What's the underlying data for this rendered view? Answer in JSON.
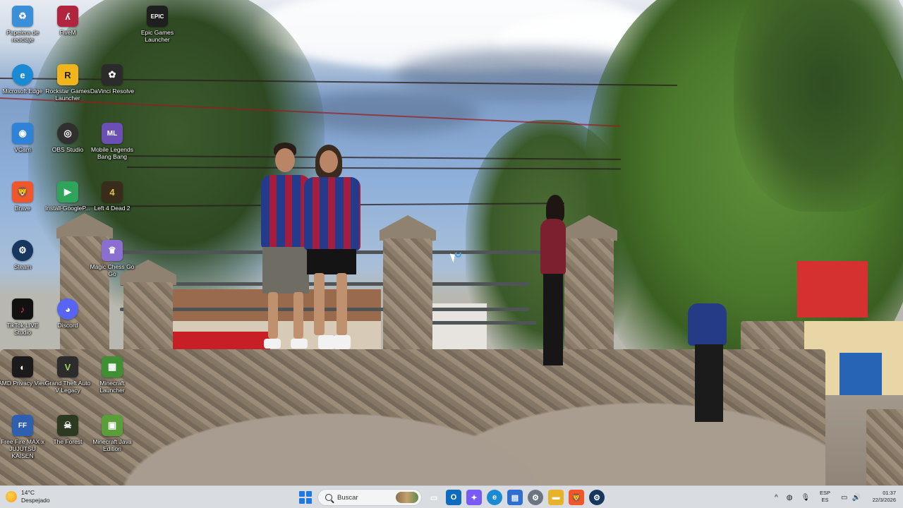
{
  "desktop_icons": [
    {
      "label": "Papelera de reciclaje",
      "icon": "recycle-bin-icon",
      "color": "#3a8fd9",
      "glyph": "♻"
    },
    {
      "label": "FiveM",
      "icon": "fivem-icon",
      "color": "#b2253f",
      "glyph": "ʎ"
    },
    {
      "label": "Epic Games Launcher",
      "icon": "epic-games-icon",
      "color": "#1f1f1f",
      "glyph": "EPIC"
    },
    {
      "label": "Microsoft Edge",
      "icon": "edge-icon",
      "color": "#1a8ad4",
      "glyph": "e"
    },
    {
      "label": "Rockstar Games Launcher",
      "icon": "rockstar-icon",
      "color": "#f0b51c",
      "glyph": "R"
    },
    {
      "label": "DaVinci Resolve",
      "icon": "davinci-icon",
      "color": "#2b2b2b",
      "glyph": "✿"
    },
    {
      "label": "VCam",
      "icon": "vcam-icon",
      "color": "#2e82d8",
      "glyph": "◉"
    },
    {
      "label": "OBS Studio",
      "icon": "obs-icon",
      "color": "#303030",
      "glyph": "◎"
    },
    {
      "label": "Mobile Legends Bang Bang",
      "icon": "mlbb-icon",
      "color": "#6b4fb5",
      "glyph": "ML"
    },
    {
      "label": "Brave",
      "icon": "brave-icon",
      "color": "#f1562b",
      "glyph": "🦁"
    },
    {
      "label": "Install-GoogleP...",
      "icon": "google-play-icon",
      "color": "#2fa45a",
      "glyph": "▶"
    },
    {
      "label": "Left 4 Dead 2",
      "icon": "l4d2-icon",
      "color": "#3a2c1a",
      "glyph": "4"
    },
    {
      "label": "Steam",
      "icon": "steam-icon",
      "color": "#17375e",
      "glyph": "⚙"
    },
    {
      "label": "Magic Chess Go Go",
      "icon": "magic-chess-icon",
      "color": "#8a6fd1",
      "glyph": "♛"
    },
    {
      "label": "TikTok LIVE Studio",
      "icon": "tiktok-icon",
      "color": "#111111",
      "glyph": "♪"
    },
    {
      "label": "Discord",
      "icon": "discord-icon",
      "color": "#5865f2",
      "glyph": "◕"
    },
    {
      "label": "AMD Privacy View",
      "icon": "amd-privacy-icon",
      "color": "#1b1b1b",
      "glyph": "◐"
    },
    {
      "label": "Grand Theft Auto V Legacy",
      "icon": "gta-v-icon",
      "color": "#2c2c2c",
      "glyph": "V"
    },
    {
      "label": "Minecraft Launcher",
      "icon": "minecraft-launcher-icon",
      "color": "#3f8f33",
      "glyph": "▦"
    },
    {
      "label": "Free Fire MAX x JUJUTSU KAISEN",
      "icon": "free-fire-icon",
      "color": "#2f5fb0",
      "glyph": "FF"
    },
    {
      "label": "The Forest",
      "icon": "the-forest-icon",
      "color": "#2d3a22",
      "glyph": "☠"
    },
    {
      "label": "Minecraft Java Edition",
      "icon": "minecraft-java-icon",
      "color": "#5a9e3a",
      "glyph": "▣"
    }
  ],
  "taskbar": {
    "weather_temp": "14°C",
    "weather_desc": "Despejado",
    "search_placeholder": "Buscar",
    "apps": [
      {
        "name": "task-view-icon",
        "color": "#5b6470",
        "glyph": "▭"
      },
      {
        "name": "outlook-icon",
        "color": "#0f6cbd",
        "glyph": "O"
      },
      {
        "name": "copilot-icon",
        "color": "#7a5af5",
        "glyph": "✦"
      },
      {
        "name": "edge-taskbar-icon",
        "color": "#1a8ad4",
        "glyph": "e"
      },
      {
        "name": "store-icon",
        "color": "#2f6fd1",
        "glyph": "▤"
      },
      {
        "name": "settings-icon",
        "color": "#6b7480",
        "glyph": "⚙"
      },
      {
        "name": "file-explorer-icon",
        "color": "#e7b32b",
        "glyph": "▬"
      },
      {
        "name": "brave-taskbar-icon",
        "color": "#f1562b",
        "glyph": "🦁"
      },
      {
        "name": "steam-taskbar-icon",
        "color": "#17375e",
        "glyph": "⚙"
      }
    ],
    "tray_chevron": "^",
    "language_top": "ESP",
    "language_bottom": "ES",
    "time": "01:37",
    "date": "22/3/2026"
  }
}
